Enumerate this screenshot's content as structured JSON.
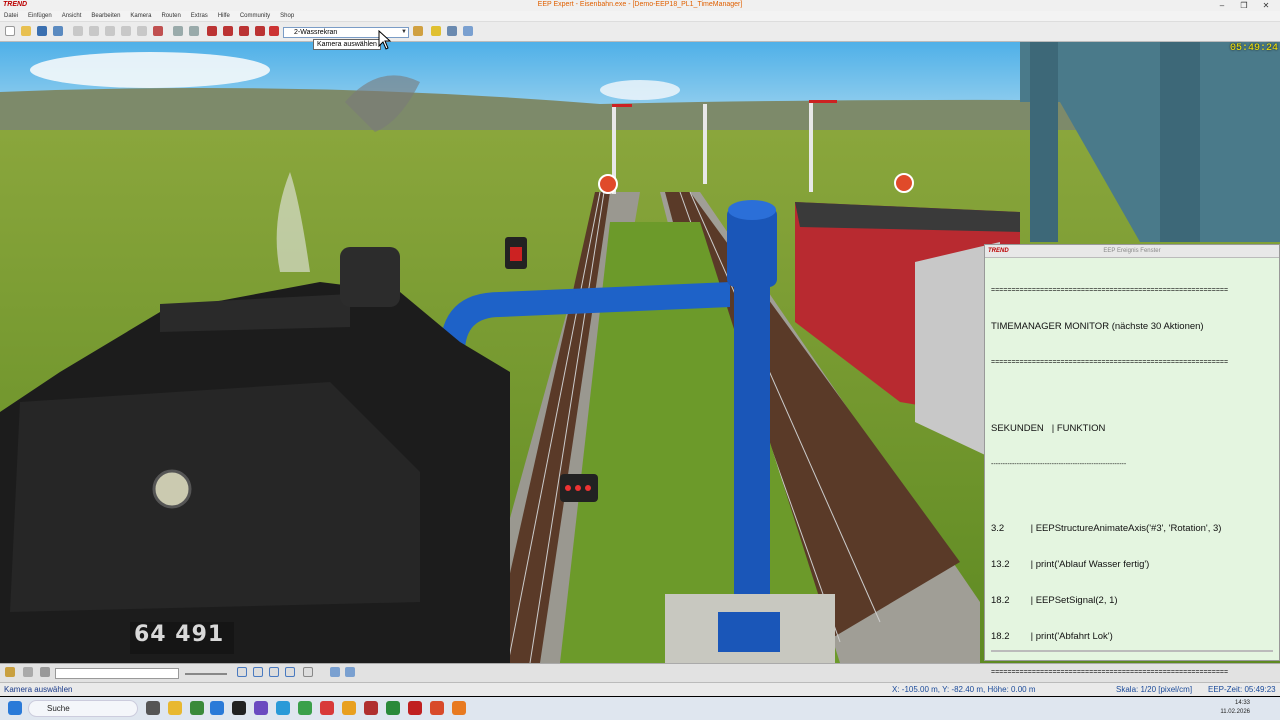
{
  "window": {
    "logo": "TREND",
    "title": "EEP Expert - Eisenbahn.exe - [Demo-EEP18_PL1_TimeManager]",
    "min": "–",
    "max": "❒",
    "close": "✕"
  },
  "menu": [
    "Datei",
    "Einfügen",
    "Ansicht",
    "Bearbeiten",
    "Kamera",
    "Routen",
    "Extras",
    "Hilfe",
    "Community",
    "Shop"
  ],
  "toolbar": {
    "camera_select": "2-Wassrekran",
    "tooltip": "Kamera auswählen"
  },
  "scene": {
    "clock": "05:49:24",
    "loco_number": "64 491"
  },
  "event_window": {
    "logo": "TREND",
    "title": "EEP Ereignis Fenster",
    "lines": [
      "==========================================================",
      "TIMEMANAGER MONITOR (nächste 30 Aktionen)",
      "==========================================================",
      "SEKUNDEN   | FUNKTION",
      "----------------------------------------------------------",
      "3.2          | EEPStructureAnimateAxis('#3', 'Rotation', 3)",
      "13.2        | print('Ablauf Wasser fertig')",
      "18.2        | EEPSetSignal(2, 1)",
      "18.2        | print('Abfahrt Lok')",
      "=========================================================="
    ]
  },
  "statusbar": {
    "left": "Kamera auswählen",
    "coords": "X: -105.00 m, Y: -82.40 m, Höhe: 0.00 m",
    "scale": "Skala: 1/20 [pixel/cm]",
    "eep_time": "EEP-Zeit: 05:49:23"
  },
  "taskbar": {
    "search": "Suche",
    "time": "14:33",
    "date": "11.02.2026"
  }
}
